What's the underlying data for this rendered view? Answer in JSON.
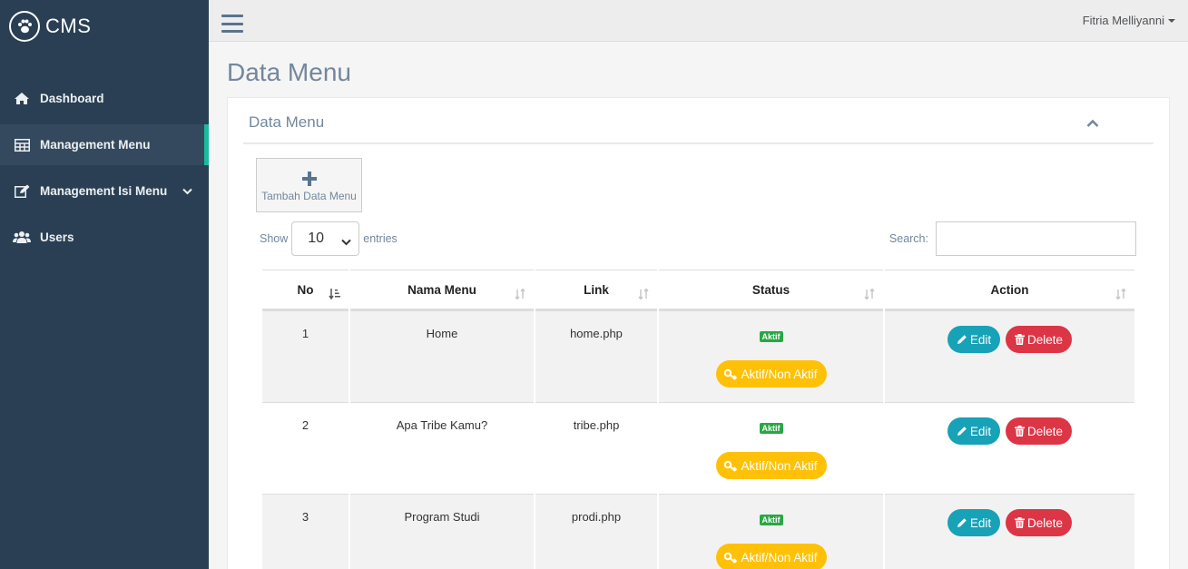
{
  "brand": {
    "name": "CMS"
  },
  "sidebar": {
    "items": [
      {
        "label": "Dashboard"
      },
      {
        "label": "Management Menu"
      },
      {
        "label": "Management Isi Menu"
      },
      {
        "label": "Users"
      }
    ]
  },
  "topbar": {
    "user": "Fitria Melliyanni"
  },
  "page": {
    "title": "Data Menu"
  },
  "panel": {
    "title": "Data Menu",
    "add_label": "Tambah Data Menu",
    "show_label": "Show",
    "entries_value": "10",
    "entries_label": "entries",
    "search_label": "Search:"
  },
  "table": {
    "headers": [
      "No",
      "Nama Menu",
      "Link",
      "Status",
      "Action"
    ],
    "rows": [
      {
        "no": "1",
        "name": "Home",
        "link": "home.php",
        "status": "Aktif"
      },
      {
        "no": "2",
        "name": "Apa Tribe Kamu?",
        "link": "tribe.php",
        "status": "Aktif"
      },
      {
        "no": "3",
        "name": "Program Studi",
        "link": "prodi.php",
        "status": "Aktif"
      }
    ],
    "toggle_label": "Aktif/Non Aktif",
    "edit_label": "Edit",
    "delete_label": "Delete"
  }
}
